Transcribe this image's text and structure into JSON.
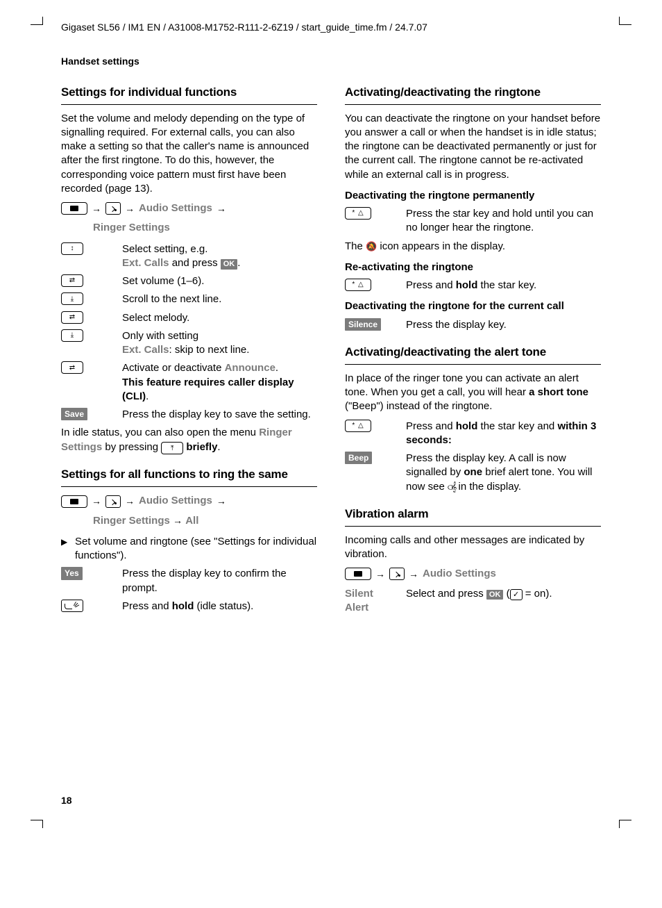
{
  "header": "Gigaset SL56 / IM1 EN / A31008-M1752-R111-2-6Z19 / start_guide_time.fm / 24.7.07",
  "sectionTop": "Handset settings",
  "pageNumber": "18",
  "left": {
    "h_individual": "Settings for individual functions",
    "p_individual": "Set the volume and melody depending on the type of signalling required. For external calls, you can also make a setting so that the caller's name is announced after the first ringtone. To do this, however, the corresponding voice pattern must first have been recorded (page 13).",
    "nav1_audio": "Audio Settings",
    "nav1_ringer": "Ringer Settings",
    "steps": {
      "s1a": "Select setting, e.g.",
      "s1b": "Ext. Calls",
      "s1c": " and press ",
      "s1d": ".",
      "s2": "Set volume (1–6).",
      "s3": "Scroll to the next line.",
      "s4": "Select melody.",
      "s5a": "Only with setting ",
      "s5b": "Ext. Calls",
      "s5c": ": skip to next line.",
      "s6a": "Activate or deactivate ",
      "s6b": "Announce",
      "s6c": ".",
      "s6d": "This feature requires caller display (CLI)",
      "s6e": ".",
      "save_label": "Save",
      "s7": "Press the display key to save the setting."
    },
    "idle_a": "In idle status, you can also open the menu ",
    "idle_b": "Ringer Settings",
    "idle_c": " by pressing ",
    "idle_d": "briefly",
    "idle_e": ".",
    "h_all": "Settings for all functions to ring the same",
    "nav2_all": "All",
    "all_bullet": "Set volume and ringtone (see \"Settings for individual functions\").",
    "yes_label": "Yes",
    "yes_text": "Press the display key to confirm the prompt.",
    "hangup_a": "Press and ",
    "hangup_b": "hold",
    "hangup_c": " (idle status)."
  },
  "right": {
    "h_ringtone": "Activating/deactivating the ringtone",
    "p_ringtone": "You can deactivate the ringtone on your handset before you answer a call or when the handset is in idle status; the ringtone can be deactivated permanently or just for the current call. The ringtone cannot be re-activated while an external call is in progress.",
    "h_deact_perm": "Deactivating the ringtone permanently",
    "deact_perm_text": "Press the star key and hold until you can no longer hear the ringtone.",
    "icon_line_a": "The ",
    "icon_line_b": " icon appears in the display.",
    "h_react": "Re-activating the ringtone",
    "react_a": "Press and ",
    "react_b": "hold",
    "react_c": " the star key.",
    "h_deact_cur": "Deactivating the ringtone for the current call",
    "silence_label": "Silence",
    "silence_text": "Press the display key.",
    "h_alert": "Activating/deactivating the alert tone",
    "p_alert_a": "In place of the ringer tone you can activate an alert tone. When you get a call, you will hear ",
    "p_alert_b": "a short tone",
    "p_alert_c": " (\"Beep\") instead of the ringtone.",
    "alert_star_a": "Press and ",
    "alert_star_b": "hold",
    "alert_star_c": " the star key and ",
    "alert_star_d": "within 3 seconds:",
    "beep_label": "Beep",
    "beep_a": "Press the display key. A call is now signalled by ",
    "beep_b": "one",
    "beep_c": " brief alert tone. You will now see ",
    "beep_d": " in the display.",
    "h_vib": "Vibration alarm",
    "p_vib": "Incoming calls and other messages are indicated by vibration.",
    "nav_audio": "Audio Settings",
    "silent_label": "Silent Alert",
    "silent_a": "Select and press ",
    "silent_b": " (",
    "silent_c": " = on)."
  },
  "badges": {
    "ok": "OK"
  },
  "key_labels": {
    "star": "* △"
  }
}
